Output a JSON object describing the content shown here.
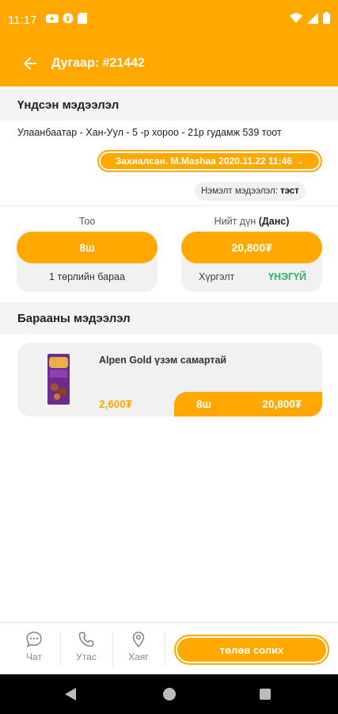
{
  "status_bar": {
    "time": "11:17"
  },
  "header": {
    "title": "Дугаар: #21442"
  },
  "basic_info": {
    "section_title": "Үндсэн мэдээлэл",
    "address": "Улаанбаатар - Хан-Уул - 5 -р хороо - 21р гудамж 539 тоот",
    "status_text": "Захиалсан. M.Mashaa 2020.11.22 11:46 →",
    "extra_label": "Нэмэлт мэдээлэл:",
    "extra_value": "тэст"
  },
  "summary": {
    "qty_label": "Тоо",
    "qty_value": "8ш",
    "product_types": "1 төрлийн бараа",
    "total_label": "Нийт дүн",
    "total_method": "(Данс)",
    "total_value": "20,800₮",
    "delivery_label": "Хүргэлт",
    "delivery_value": "ҮНЭГҮЙ"
  },
  "products": {
    "section_title": "Барааны мэдээлэл",
    "items": [
      {
        "name": "Alpen Gold үзэм самартай",
        "price": "2,600₮",
        "qty": "8ш",
        "total": "20,800₮"
      }
    ]
  },
  "bottom_nav": {
    "chat_label": "Чат",
    "phone_label": "Утас",
    "address_label": "Хаяг",
    "action_label": "төлөв солих"
  },
  "colors": {
    "accent": "#FFA800",
    "success": "#2DB36B"
  },
  "icons": [
    "back-arrow-icon",
    "chat-icon",
    "phone-icon",
    "location-pin-icon"
  ]
}
